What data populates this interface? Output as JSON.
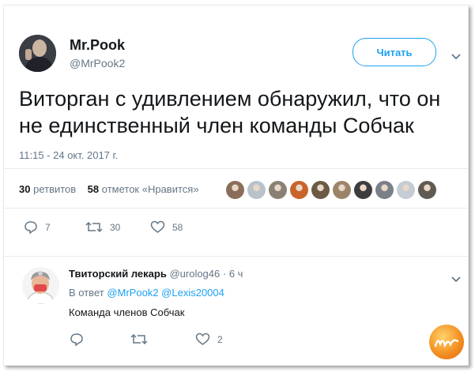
{
  "tweet": {
    "author_name": "Mr.Pook",
    "author_handle": "@MrPook2",
    "follow_label": "Читать",
    "text": "Виторган с удивлением обнаружил, что он не единственный член команды Собчак",
    "timestamp": "11:15 - 24 окт. 2017 г.",
    "retweets_count": "30",
    "retweets_label": "ретвитов",
    "likes_count": "58",
    "likes_label": "отметок «Нравится»",
    "liker_avatar_colors": [
      "#8a6d5a",
      "#b9c2c9",
      "#8a8174",
      "#c8642a",
      "#6b5a44",
      "#9c8468",
      "#3d3d3d",
      "#7a8088",
      "#c5ccd3",
      "#5f5a52"
    ],
    "actions": {
      "replies": "7",
      "retweets": "30",
      "likes": "58"
    }
  },
  "reply": {
    "author_name": "Твиторский лекарь",
    "author_handle": "@urolog46",
    "time": "· 6 ч",
    "in_reply_prefix": "В ответ",
    "mentions": [
      "@MrPook2",
      "@Lexis20004"
    ],
    "text": "Команда членов Собчак",
    "actions": {
      "likes": "2"
    }
  },
  "colors": {
    "accent": "#1da1f2",
    "muted": "#657786",
    "text": "#14171a",
    "border": "#e6ecf0"
  }
}
